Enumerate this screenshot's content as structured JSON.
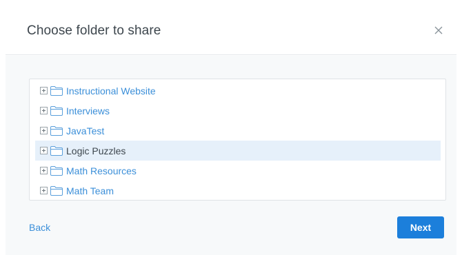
{
  "dialog": {
    "title": "Choose folder to share",
    "close_icon": "close-icon"
  },
  "tree": {
    "items": [
      {
        "label": "Instructional Website",
        "selected": false
      },
      {
        "label": "Interviews",
        "selected": false
      },
      {
        "label": "JavaTest",
        "selected": false
      },
      {
        "label": "Logic Puzzles",
        "selected": true
      },
      {
        "label": "Math Resources",
        "selected": false
      },
      {
        "label": "Math Team",
        "selected": false
      }
    ]
  },
  "footer": {
    "back_label": "Back",
    "next_label": "Next"
  },
  "colors": {
    "accent": "#1c7fdb",
    "link": "#3b8fd9",
    "selected_row": "#e6f0fa"
  }
}
